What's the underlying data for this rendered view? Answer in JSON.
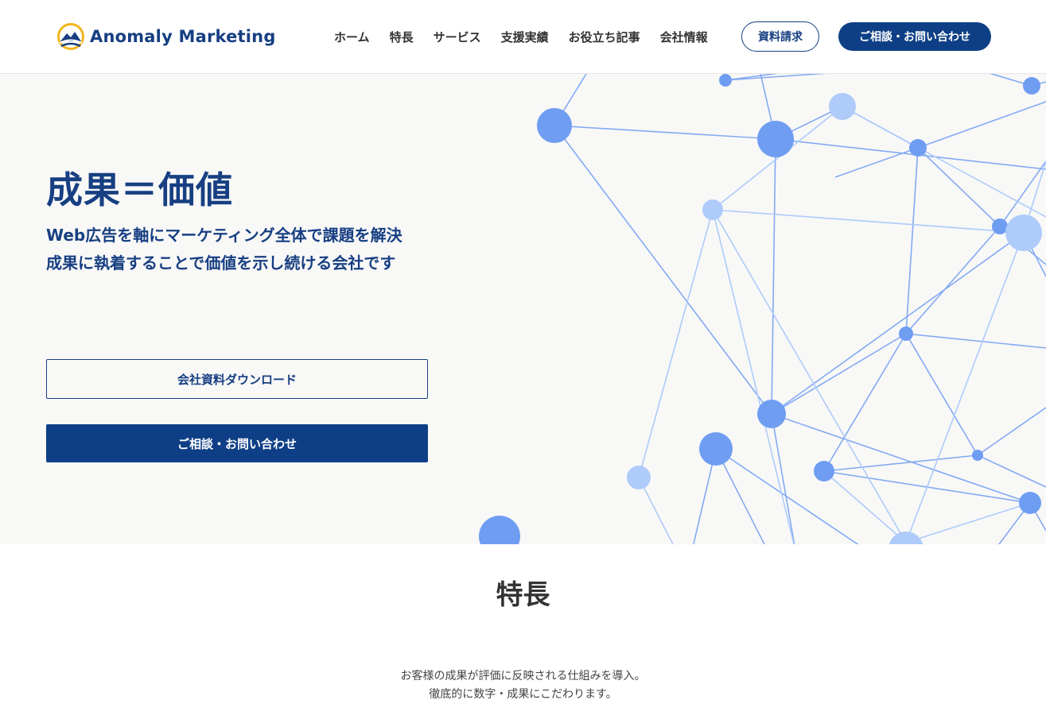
{
  "header": {
    "logo_text": "Anomaly Marketing",
    "nav": [
      "ホーム",
      "特長",
      "サービス",
      "支援実績",
      "お役立ち記事",
      "会社情報"
    ],
    "doc_button": "資料請求",
    "contact_button": "ご相談・お問い合わせ"
  },
  "hero": {
    "title": "成果＝価値",
    "subtitle_line1": "Web広告を軸にマーケティング全体で課題を解決",
    "subtitle_line2": "成果に執着することで価値を示し続ける会社です",
    "download_button": "会社資料ダウンロード",
    "contact_button": "ご相談・お問い合わせ"
  },
  "features": {
    "title": "特長",
    "desc_line1": "お客様の成果が評価に反映される仕組みを導入。",
    "desc_line2": "徹底的に数字・成果にこだわります。"
  },
  "colors": {
    "brand": "#173f82",
    "button": "#0e3f86",
    "hero_bg": "#f8f8f7",
    "node_dark": "#6f9df2",
    "node_light": "#aecbfa",
    "logo_yellow": "#f2b51c"
  }
}
